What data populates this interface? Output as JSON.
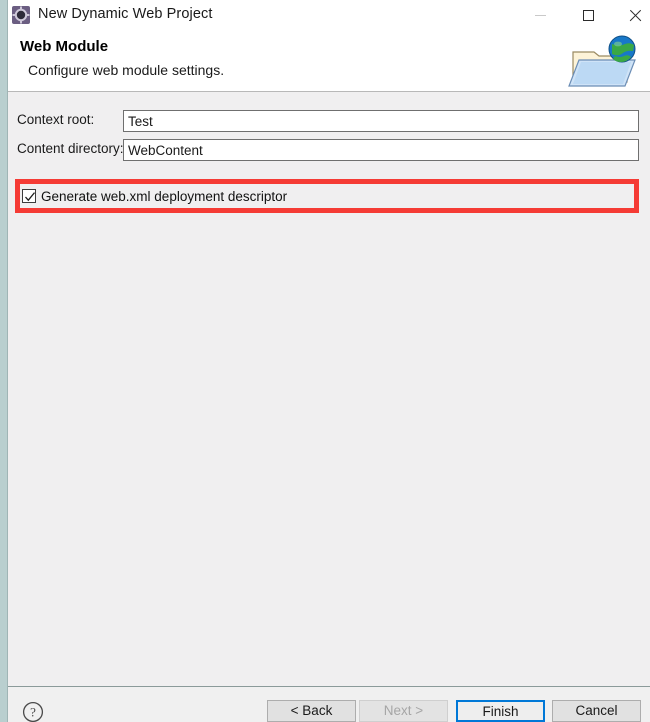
{
  "window": {
    "title": "New Dynamic Web Project",
    "app_icon": "eclipse-project-icon",
    "controls": {
      "minimize": "minimize-icon",
      "maximize": "maximize-icon",
      "close": "close-icon"
    }
  },
  "header": {
    "title": "Web Module",
    "subtitle": "Configure web module settings.",
    "icon": "web-folder-globe-icon"
  },
  "form": {
    "fields": [
      {
        "label": "Context root:",
        "value": "Test",
        "placeholder": ""
      },
      {
        "label": "Content directory:",
        "value": "WebContent",
        "placeholder": ""
      }
    ],
    "checkbox": {
      "label": "Generate web.xml deployment descriptor",
      "checked": true,
      "highlight_color": "#f53b35"
    }
  },
  "footer": {
    "help": "help-icon",
    "buttons": [
      {
        "label": "< Back",
        "enabled": true
      },
      {
        "label": "Next >",
        "enabled": false
      },
      {
        "label": "Finish",
        "enabled": true,
        "focused": true
      },
      {
        "label": "Cancel",
        "enabled": true
      }
    ]
  },
  "colors": {
    "accent": "#0078d7",
    "highlight": "#f53b35",
    "dialog_background": "#f0eff0",
    "titlebar_background": "#ffffff"
  }
}
